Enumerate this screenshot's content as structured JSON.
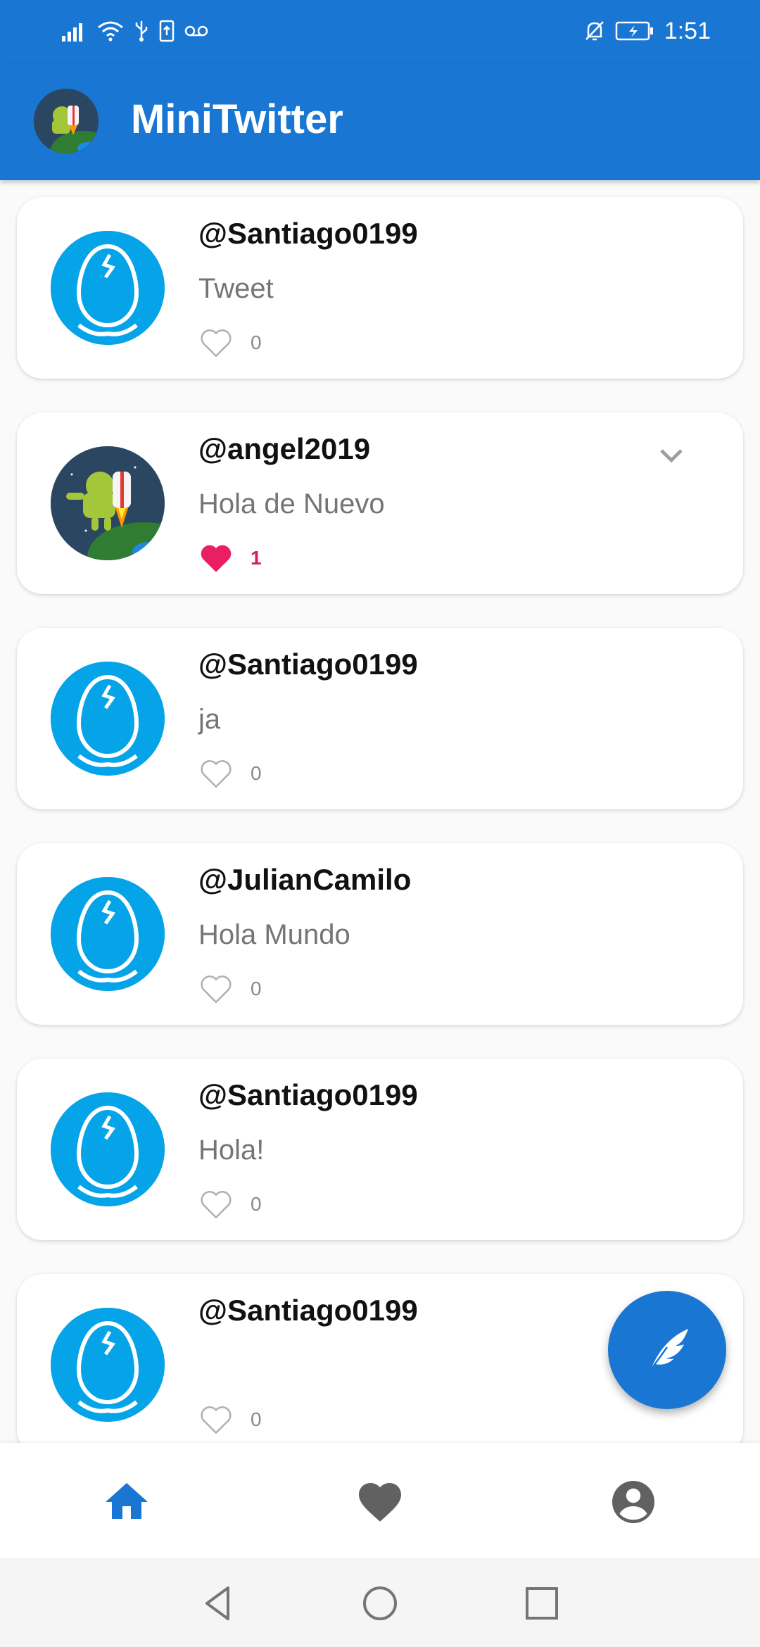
{
  "status_bar": {
    "time": "1:51",
    "left_icons": [
      "signal-icon",
      "wifi-icon",
      "usb-icon",
      "sim-icon",
      "voicemail-icon"
    ],
    "right_icons": [
      "notifications-off-icon",
      "battery-charging-icon"
    ]
  },
  "app_bar": {
    "title": "MiniTwitter",
    "avatar_icon": "android-astronaut-avatar"
  },
  "tweets": [
    {
      "username": "@Santiago0199",
      "message": "Tweet",
      "likes": "0",
      "liked": false,
      "avatar": "egg-avatar"
    },
    {
      "username": "@angel2019",
      "message": "Hola de Nuevo",
      "likes": "1",
      "liked": true,
      "avatar": "android-astronaut-avatar",
      "menu_icon": "chevron-down-icon"
    },
    {
      "username": "@Santiago0199",
      "message": "ja",
      "likes": "0",
      "liked": false,
      "avatar": "egg-avatar"
    },
    {
      "username": "@JulianCamilo",
      "message": "Hola Mundo",
      "likes": "0",
      "liked": false,
      "avatar": "egg-avatar"
    },
    {
      "username": "@Santiago0199",
      "message": "Hola!",
      "likes": "0",
      "liked": false,
      "avatar": "egg-avatar"
    },
    {
      "username": "@Santiago0199",
      "message": "",
      "likes": "0",
      "liked": false,
      "avatar": "egg-avatar"
    }
  ],
  "fab": {
    "icon": "feather-icon"
  },
  "bottom_nav": [
    {
      "icon": "home-icon",
      "active": true
    },
    {
      "icon": "heart-icon",
      "active": false
    },
    {
      "icon": "account-circle-icon",
      "active": false
    }
  ],
  "system_nav": [
    "back-icon",
    "home-circle-icon",
    "recents-icon"
  ],
  "colors": {
    "primary": "#1976d2",
    "like_active": "#d81b60",
    "egg_blue": "#05a3e8",
    "text_secondary": "#757575"
  }
}
